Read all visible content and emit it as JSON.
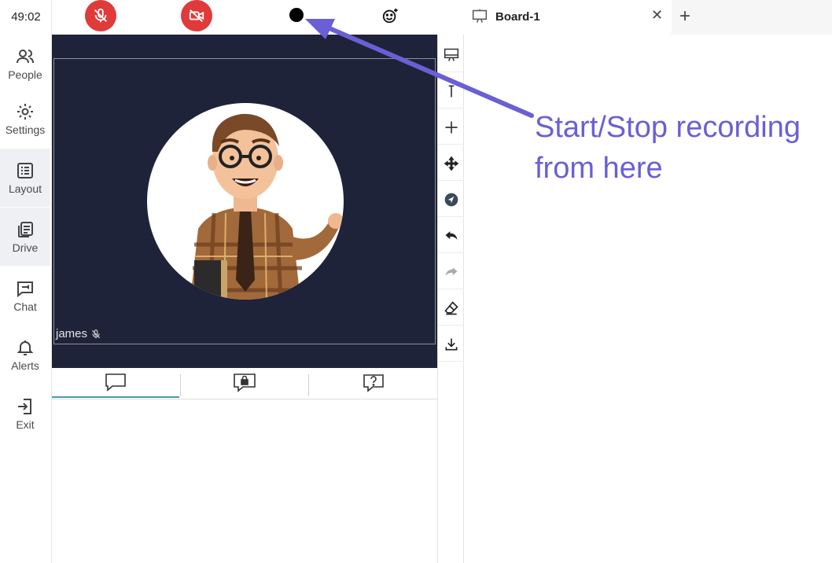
{
  "sidebar": {
    "timer": "49:02",
    "items": [
      {
        "label": "People",
        "icon": "people-icon"
      },
      {
        "label": "Settings",
        "icon": "gear-icon"
      },
      {
        "label": "Layout",
        "icon": "layout-icon"
      },
      {
        "label": "Drive",
        "icon": "drive-icon"
      },
      {
        "label": "Chat",
        "icon": "chat-icon"
      },
      {
        "label": "Alerts",
        "icon": "bell-icon"
      },
      {
        "label": "Exit",
        "icon": "exit-icon"
      }
    ]
  },
  "controls": {
    "mic": {
      "icon": "mic-off-icon",
      "state": "muted",
      "color": "#e03a3a"
    },
    "camera": {
      "icon": "camera-off-icon",
      "state": "off",
      "color": "#e03a3a"
    },
    "record": {
      "icon": "record-icon"
    },
    "reaction": {
      "icon": "emoji-add-icon"
    }
  },
  "video": {
    "participant_name": "james",
    "participant_muted_icon": "mic-off-icon",
    "background_color": "#1e2339"
  },
  "chat_tabs": [
    {
      "icon": "chat-bubble-icon",
      "active": true
    },
    {
      "icon": "private-chat-icon",
      "active": false
    },
    {
      "icon": "question-icon",
      "active": false
    }
  ],
  "whiteboard_tools": [
    {
      "icon": "presentation-icon"
    },
    {
      "icon": "text-icon"
    },
    {
      "icon": "plus-icon"
    },
    {
      "icon": "move-icon"
    },
    {
      "icon": "navigate-icon"
    },
    {
      "icon": "undo-icon"
    },
    {
      "icon": "redo-icon"
    },
    {
      "icon": "eraser-icon"
    },
    {
      "icon": "download-icon"
    }
  ],
  "board": {
    "tab_title": "Board-1",
    "tab_icon": "presentation-icon"
  },
  "annotation": {
    "line1": "Start/Stop recording",
    "line2": "from here",
    "color": "#6a5fd6"
  }
}
